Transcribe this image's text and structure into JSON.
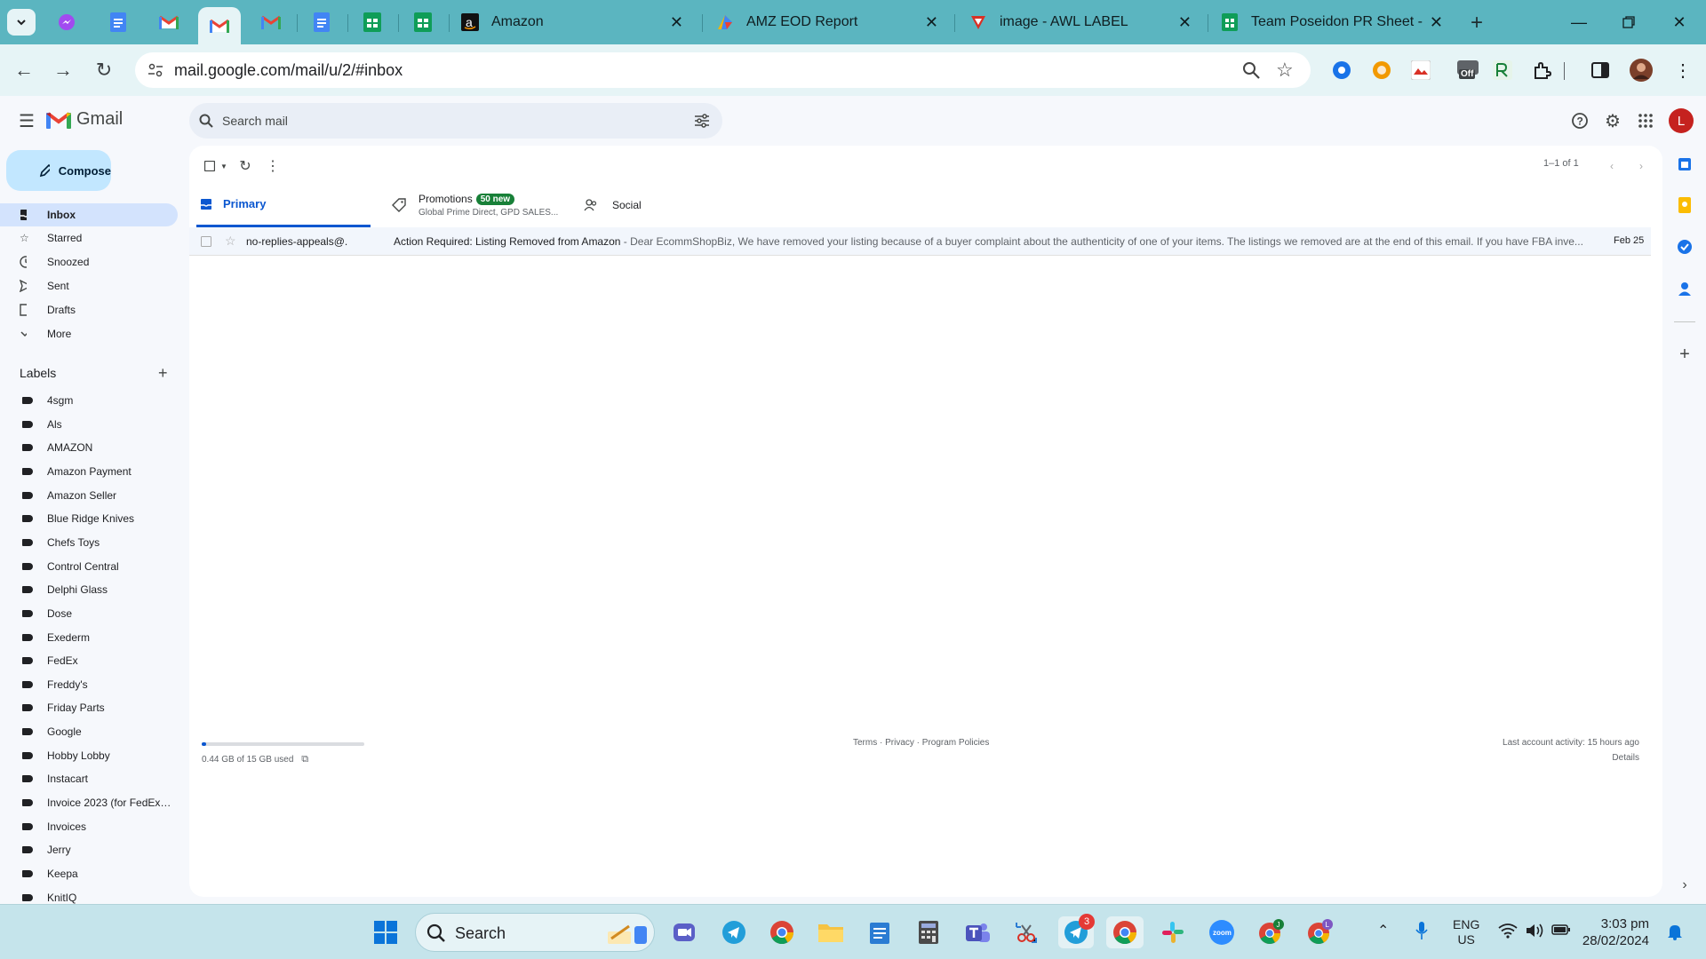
{
  "browser": {
    "tabs": [
      {
        "title": "Amazon",
        "icon": "amazon-icon"
      },
      {
        "title": "AMZ EOD Report",
        "icon": "report-icon"
      },
      {
        "title": "image - AWL LABEL",
        "icon": "awl-icon"
      },
      {
        "title": "Team Poseidon PR Sheet - Go",
        "icon": "sheets-icon"
      }
    ],
    "url": "mail.google.com/mail/u/2/#inbox",
    "extension_badge": "Off"
  },
  "gmail": {
    "brand": "Gmail",
    "search_placeholder": "Search mail",
    "avatar_letter": "L",
    "compose_label": "Compose",
    "nav": [
      {
        "label": "Inbox",
        "icon": "inbox-icon"
      },
      {
        "label": "Starred",
        "icon": "star-icon"
      },
      {
        "label": "Snoozed",
        "icon": "clock-icon"
      },
      {
        "label": "Sent",
        "icon": "send-icon"
      },
      {
        "label": "Drafts",
        "icon": "draft-icon"
      },
      {
        "label": "More",
        "icon": "chevron-down-icon"
      }
    ],
    "labels_heading": "Labels",
    "labels": [
      "4sgm",
      "Als",
      "AMAZON",
      "Amazon Payment",
      "Amazon Seller",
      "Blue Ridge Knives",
      "Chefs Toys",
      "Control Central",
      "Delphi Glass",
      "Dose",
      "Exederm",
      "FedEx",
      "Freddy's",
      "Friday Parts",
      "Google",
      "Hobby Lobby",
      "Instacart",
      "Invoice 2023 (for FedEx ...",
      "Invoices",
      "Jerry",
      "Keepa",
      "KnitIQ"
    ],
    "paging": "1–1 of 1",
    "categories": {
      "primary": "Primary",
      "promotions": "Promotions",
      "promotions_badge": "50 new",
      "promotions_sub": "Global Prime Direct, GPD SALES...",
      "social": "Social"
    },
    "emails": [
      {
        "sender": "no-replies-appeals@.",
        "subject": "Action Required: Listing Removed from Amazon",
        "snippet": " - Dear EcommShopBiz, We have removed your listing because of a buyer complaint about the authenticity of one of your items. The listings we removed are at the end of this email. If you have FBA inve...",
        "date": "Feb 25"
      }
    ],
    "storage_text": "0.44 GB of 15 GB used",
    "storage_fraction": 0.03,
    "footer_links": "Terms · Privacy · Program Policies",
    "last_activity": "Last account activity: 15 hours ago",
    "details": "Details"
  },
  "taskbar": {
    "search_placeholder": "Search",
    "telegram_badge": "3",
    "lang": "ENG",
    "region": "US",
    "time": "3:03 pm",
    "date": "28/02/2024"
  },
  "colors": {
    "accent": "#0b57d0",
    "tabbar": "#5bb5c0",
    "compose": "#c2e7ff"
  }
}
